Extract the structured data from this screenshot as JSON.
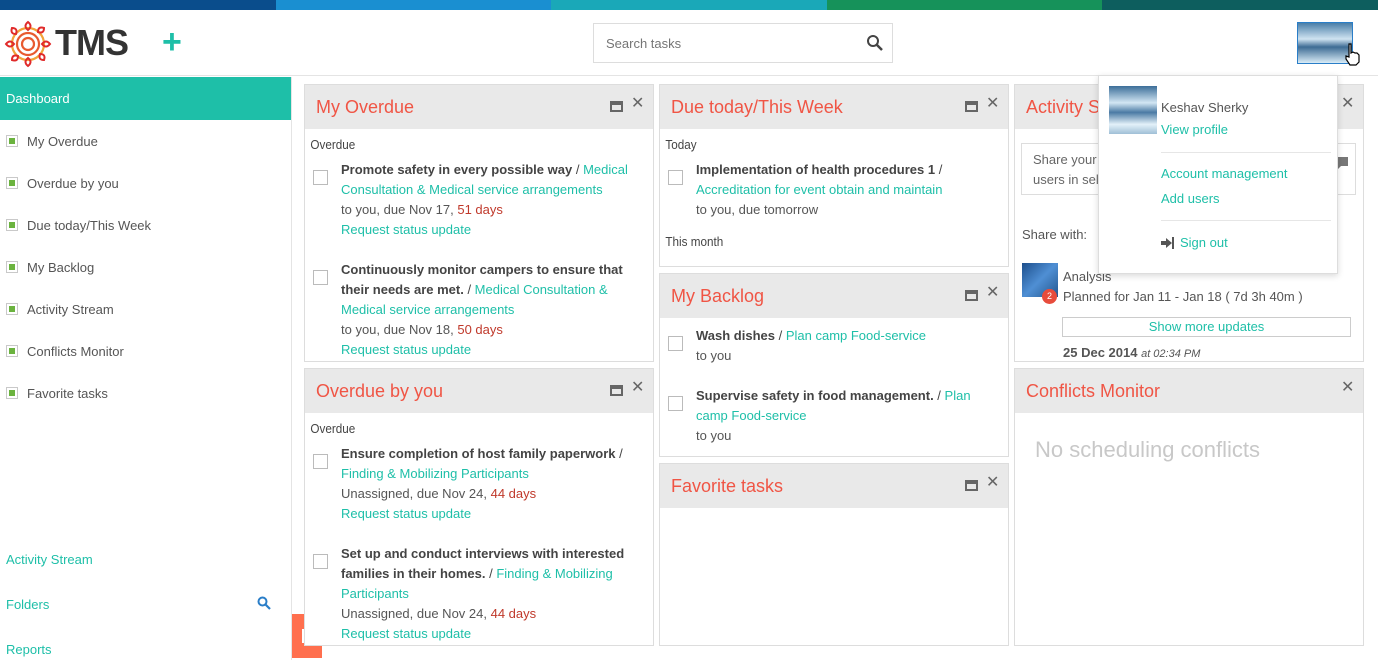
{
  "colors": {
    "accent": "#1ebfa8",
    "widget_title": "#f05545",
    "overdue_days": "#c0392b",
    "stripe": [
      "#0a4d8c",
      "#1a8fd1",
      "#1aa8b8",
      "#16925a",
      "#0d5e5e"
    ]
  },
  "header": {
    "logo_text": "TMS",
    "add_label": "+",
    "search_placeholder": "Search tasks"
  },
  "sidebar": {
    "active_label": "Dashboard",
    "items": [
      {
        "label": "My Overdue"
      },
      {
        "label": "Overdue by you"
      },
      {
        "label": "Due today/This Week"
      },
      {
        "label": "My Backlog"
      },
      {
        "label": "Activity Stream"
      },
      {
        "label": "Conflicts Monitor"
      },
      {
        "label": "Favorite tasks"
      }
    ],
    "bottom_links": [
      {
        "label": "Activity Stream"
      },
      {
        "label": "Folders"
      },
      {
        "label": "Reports"
      }
    ]
  },
  "widgets": {
    "my_overdue": {
      "title": "My Overdue",
      "section": "Overdue",
      "tasks": [
        {
          "name": "Promote safety in every possible way",
          "sep": " / ",
          "project": "Medical Consultation & Medical service arrangements",
          "meta": "to you, due Nov 17, ",
          "days": "51 days",
          "action": "Request status update"
        },
        {
          "name": "Continuously monitor campers to ensure that their needs are met.",
          "sep": " / ",
          "project": "Medical Consultation & Medical service arrangements",
          "meta": "to you, due Nov 18, ",
          "days": "50 days",
          "action": "Request status update"
        }
      ]
    },
    "overdue_by_you": {
      "title": "Overdue by you",
      "section": "Overdue",
      "tasks": [
        {
          "name": "Ensure completion of host family paperwork",
          "sep": " / ",
          "project": "Finding & Mobilizing Participants",
          "meta": "Unassigned, due Nov 24, ",
          "days": "44 days",
          "action": "Request status update"
        },
        {
          "name": "Set up and conduct interviews with interested families in their homes.",
          "sep": " / ",
          "project": "Finding & Mobilizing Participants",
          "meta": "Unassigned, due Nov 24, ",
          "days": "44 days",
          "action": "Request status update"
        }
      ]
    },
    "due_today": {
      "title": "Due today/This Week",
      "section_today": "Today",
      "section_month": "This month",
      "tasks": [
        {
          "name": "Implementation of health procedures 1",
          "sep": " / ",
          "project": "Accreditation for event obtain and maintain",
          "meta": "to you, due tomorrow"
        }
      ]
    },
    "my_backlog": {
      "title": "My Backlog",
      "tasks": [
        {
          "name": "Wash dishes",
          "sep": " / ",
          "project": "Plan camp Food-service",
          "meta": "to you"
        },
        {
          "name": "Supervise safety in food management.",
          "sep": " / ",
          "project": "Plan camp Food-service",
          "meta": "to you"
        }
      ]
    },
    "favorite_tasks": {
      "title": "Favorite tasks"
    },
    "activity_stream": {
      "title": "Activity S",
      "share_placeholder": "Share your\nusers in sel",
      "share_with_label": "Share with:",
      "update_title": "Analysis",
      "update_detail": "Planned for Jan 11 - Jan 18 ( 7d 3h 40m )",
      "badge_count": "2",
      "show_more": "Show more updates",
      "date": "25 Dec 2014",
      "time": "at 02:34 PM"
    },
    "conflicts_monitor": {
      "title": "Conflicts Monitor",
      "empty": "No scheduling conflicts"
    }
  },
  "user_menu": {
    "name": "Keshav Sherky",
    "view_profile": "View profile",
    "account_management": "Account management",
    "add_users": "Add users",
    "sign_out": "Sign out"
  }
}
